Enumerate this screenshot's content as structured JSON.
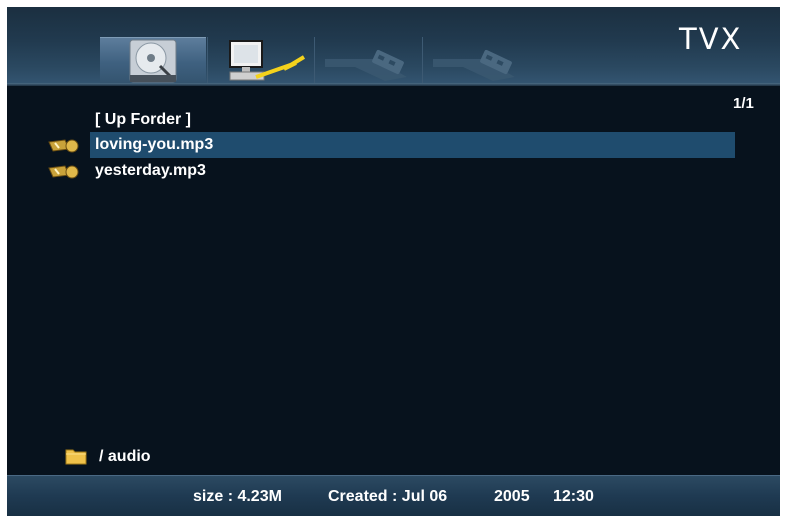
{
  "header": {
    "brand": "TVX",
    "tabs": [
      {
        "icon": "hard-disk-icon",
        "selected": true
      },
      {
        "icon": "network-pc-icon",
        "selected": false
      },
      {
        "icon": "usb-icon",
        "selected": false,
        "disabled": true
      },
      {
        "icon": "usb-icon",
        "selected": false,
        "disabled": true
      }
    ]
  },
  "page_indicator": "1/1",
  "files": [
    {
      "label": "[ Up Forder ]",
      "icon": null,
      "selected": false
    },
    {
      "label": "loving-you.mp3",
      "icon": "music-note-icon",
      "selected": true
    },
    {
      "label": "yesterday.mp3",
      "icon": "music-note-icon",
      "selected": false
    }
  ],
  "current_path": "/ audio",
  "footer": {
    "size": "size : 4.23M",
    "created": "Created : Jul 06",
    "year": "2005",
    "time": "12:30"
  },
  "colors": {
    "background": "#07121d",
    "highlight": "#1f4c6e",
    "header": "#2a4860"
  }
}
